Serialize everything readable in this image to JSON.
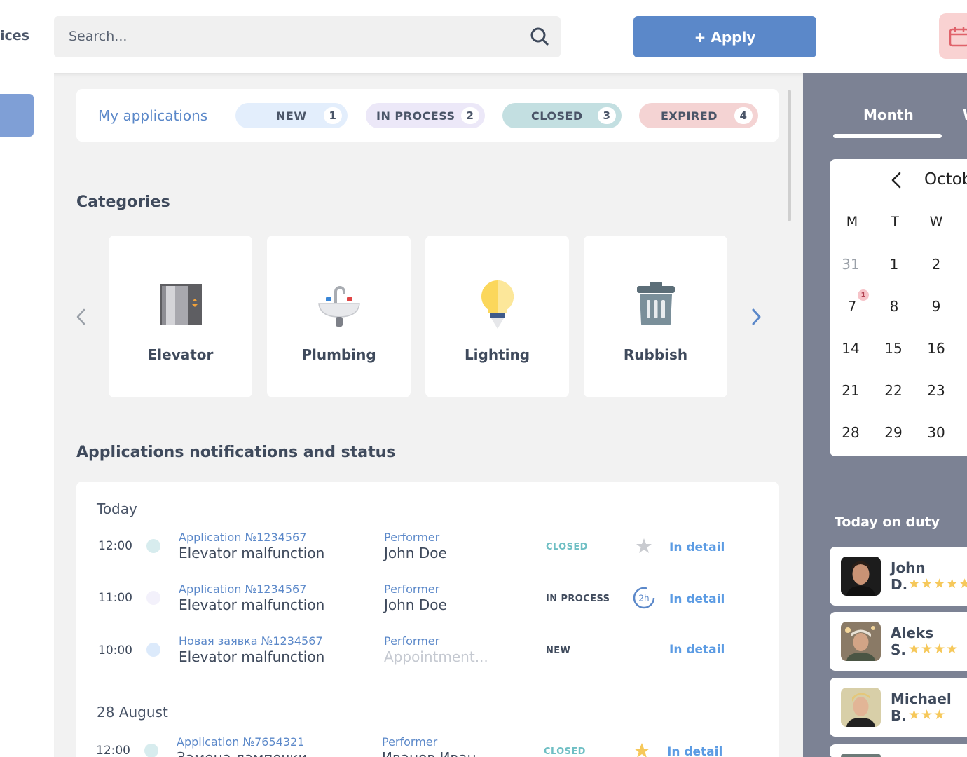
{
  "sidebar": {
    "partial_label": "ices"
  },
  "topbar": {
    "search_placeholder": "Search...",
    "apply_label": "+ Apply"
  },
  "applications": {
    "title": "My applications",
    "filters": [
      {
        "label": "NEW",
        "count": "1",
        "color": "#e3eefc"
      },
      {
        "label": "IN PROCESS",
        "count": "2",
        "color": "#ece8f8"
      },
      {
        "label": "CLOSED",
        "count": "3",
        "color": "#c3dfe1"
      },
      {
        "label": "EXPIRED",
        "count": "4",
        "color": "#f4d3d3"
      }
    ]
  },
  "categories": {
    "title": "Categories",
    "items": [
      {
        "label": "Elevator",
        "icon": "elevator-icon"
      },
      {
        "label": "Plumbing",
        "icon": "sink-icon"
      },
      {
        "label": "Lighting",
        "icon": "light-bulb-icon"
      },
      {
        "label": "Rubbish",
        "icon": "trash-bin-icon"
      }
    ]
  },
  "notifications": {
    "title": "Applications notifications and status",
    "groups": [
      {
        "day": "Today",
        "rows": [
          {
            "time": "12:00",
            "app_no": "Application №1234567",
            "app_title": "Elevator malfunction",
            "performer_label": "Performer",
            "performer": "John Doe",
            "status": "CLOSED",
            "status_color": "#6fbfc4",
            "mark": "star-grey",
            "detail": "In detail"
          },
          {
            "time": "11:00",
            "app_no": "Application №1234567",
            "app_title": "Elevator malfunction",
            "performer_label": "Performer",
            "performer": "John Doe",
            "status": "IN PROCESS",
            "status_color": "#3f4a5c",
            "mark": "timer-2h",
            "timer_label": "2h",
            "detail": "In detail"
          },
          {
            "time": "10:00",
            "app_no": "Новая заявка №1234567",
            "app_title": "Elevator malfunction",
            "performer_label": "Performer",
            "performer": "Appointment...",
            "status": "NEW",
            "status_color": "#3f4a5c",
            "mark": "none",
            "detail": "In detail"
          }
        ]
      },
      {
        "day": "28 August",
        "rows": [
          {
            "time": "12:00",
            "app_no": "Application №7654321",
            "app_title": "Замена лампочки",
            "performer_label": "Performer",
            "performer": "Иванов Иван",
            "status": "CLOSED",
            "status_color": "#6fbfc4",
            "mark": "star-yellow",
            "detail": "In detail"
          }
        ]
      }
    ]
  },
  "calendar": {
    "tabs": {
      "month": "Month",
      "week_partial": "W"
    },
    "month_label": "Octob",
    "weekdays": [
      "M",
      "T",
      "W"
    ],
    "weeks": [
      [
        "31",
        "1",
        "2"
      ],
      [
        "7",
        "8",
        "9"
      ],
      [
        "14",
        "15",
        "16"
      ],
      [
        "21",
        "22",
        "23"
      ],
      [
        "28",
        "29",
        "30"
      ]
    ],
    "badge": "1"
  },
  "duty": {
    "title": "Today on duty",
    "people": [
      {
        "first": "John",
        "last": "D.",
        "stars": "★★★★★"
      },
      {
        "first": "Aleks",
        "last": "S.",
        "stars": "★★★★"
      },
      {
        "first": "Michael",
        "last": "B.",
        "stars": "★★★"
      }
    ]
  }
}
